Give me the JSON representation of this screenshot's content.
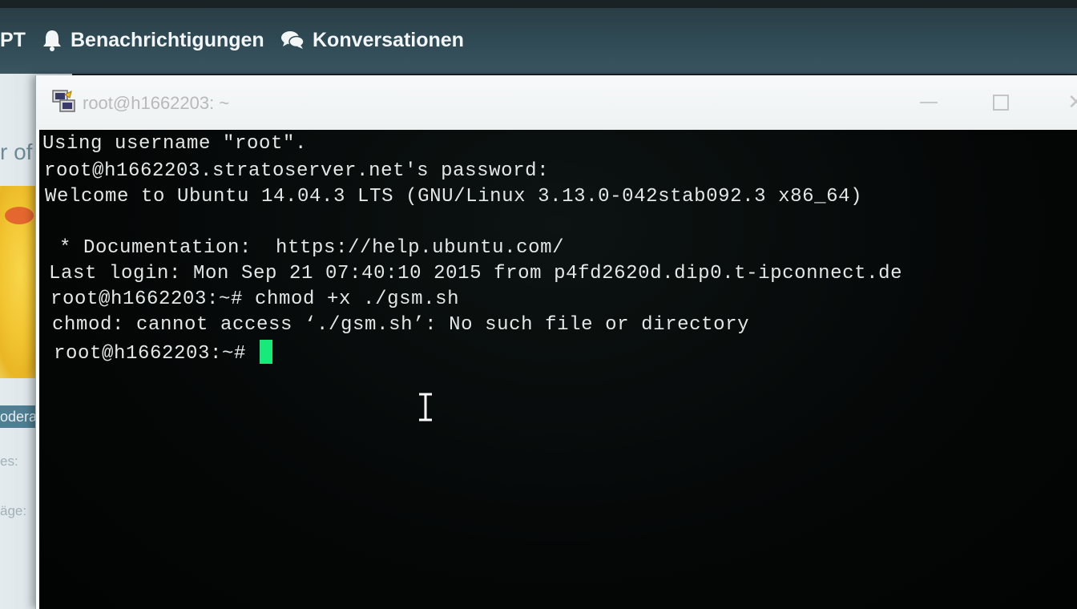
{
  "topbar": {
    "partial_label": "PT",
    "notifications": {
      "label": "Benachrichtigungen",
      "icon": "bell-icon"
    },
    "conversations": {
      "label": "Konversationen",
      "icon": "chat-bubbles-icon"
    }
  },
  "background_page": {
    "title_fragment": "r of",
    "badge_fragment": "oderato",
    "label_1": "es:",
    "label_2": "äge:"
  },
  "window": {
    "title": "root@h1662203: ~",
    "icon": "putty-icon",
    "buttons": {
      "minimize": "minimize-icon",
      "maximize": "maximize-icon",
      "close": "close-icon"
    }
  },
  "terminal": {
    "lines": [
      "Using username \"root\".",
      "root@h1662203.stratoserver.net's password:",
      "Welcome to Ubuntu 14.04.3 LTS (GNU/Linux 3.13.0-042stab092.3 x86_64)",
      "",
      " * Documentation:  https://help.ubuntu.com/",
      "Last login: Mon Sep 21 07:40:10 2015 from p4fd2620d.dip0.t-ipconnect.de",
      "root@h1662203:~# chmod +x ./gsm.sh",
      "chmod: cannot access ‘./gsm.sh’: No such file or directory"
    ],
    "prompt": "root@h1662203:~# ",
    "cursor_color": "#19e87a",
    "pointer": "text-cursor-icon"
  }
}
